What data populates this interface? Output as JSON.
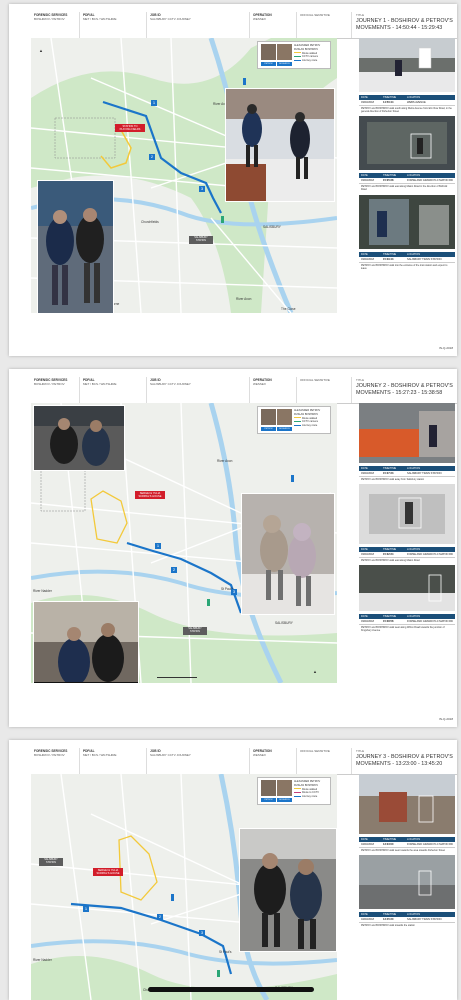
{
  "header_labels": {
    "forensic": "FORENSIC SERVICES",
    "pdf": "PDF/AL",
    "job": "JOB ID",
    "operation": "OPERATION",
    "title_label": "TITLE"
  },
  "header_values": {
    "forensic": "BOSHIROV / PETROV",
    "pdf": "MET / BCS / WILTSHIRE",
    "job": "SALISBURY CCTV JOURNEY",
    "operation": "WESSEX",
    "classification": "OFFICIAL SENSITIVE"
  },
  "pages": [
    {
      "title": "JOURNEY 1 - BOSHIROV & PETROV'S MOVEMENTS - 14:50:44 - 15:29:43",
      "map_labels": [
        "River Avon",
        "SALISBURY",
        "Churchfields",
        "River Avon",
        "The Close",
        "Bourne",
        "Wilton Road"
      ],
      "red_label": "STATION TO PLAYING FIELDS",
      "grey_label": "SALISBURY STATION",
      "nums": [
        "1",
        "2",
        "3",
        "4"
      ],
      "legend": {
        "a": "ALEXANDER PETROV",
        "b": "RUSLAN BOSHIROV",
        "c": "Route walked",
        "d": "CCTV camera",
        "e": "Journey route"
      },
      "faces": [
        "PETROV",
        "BOSHIROV"
      ],
      "table_head": [
        "DATE",
        "TIME/TIME",
        "LOCATION"
      ],
      "rows": [
        {
          "date": "03/03/2018",
          "time": "14:50:44",
          "loc": "WEBS AVENUE",
          "desc": "PETROV and BOSHIROV walk south along Webs Avenue from Elm Row Road, in the general direction of Fisherton Street"
        },
        {
          "date": "03/03/2018",
          "time": "15:05:28",
          "loc": "FORSE AND GRANDI PLC MATON RD",
          "desc": "PETROV and BOSHIROV walk east along Maton Road in the direction of Boltrold Road"
        },
        {
          "date": "03/03/2018",
          "time": "15:29:43",
          "loc": "SALISBURY TRAIN STATION",
          "desc": "PETROV and BOSHIROV walk into the entrance of the train station and expect to leave"
        }
      ],
      "footer": "IN-Q-2018"
    },
    {
      "title": "JOURNEY 2 - BOSHIROV & PETROV'S MOVEMENTS - 15:27:23 - 15:38:58",
      "map_labels": [
        "River Avon",
        "SALISBURY",
        "River Nadder",
        "St Paul's",
        "Churchfields"
      ],
      "red_label": "SERGEI & YULIA SKRIPAL'S HOUSE",
      "grey_label": "SALISBURY STATION",
      "nums": [
        "1",
        "2",
        "3",
        "4"
      ],
      "legend": {
        "a": "ALEXANDER PETROV",
        "b": "RUSLAN BOSHIROV",
        "c": "Route walked",
        "d": "CCTV camera",
        "e": "Journey route"
      },
      "faces": [
        "PETROV",
        "BOSHIROV"
      ],
      "table_head": [
        "DATE",
        "TIME/TIME",
        "LOCATION"
      ],
      "rows": [
        {
          "date": "03/03/2018",
          "time": "15:27:23",
          "loc": "SALISBURY TRAIN STATION",
          "desc": "PETROV and BOSHIROV walk away from Salisbury station"
        },
        {
          "date": "03/03/2018",
          "time": "15:32:24",
          "loc": "FORSE AND GRANDI PLC MATON RD",
          "desc": "PETROV and BOSHIROV walk east along Maton Road"
        },
        {
          "date": "03/03/2018",
          "time": "15:38:58",
          "loc": "FORSE AND GRANDI PLC MATON RD",
          "desc": "PETROV and BOSHIROV walk west along Wilton Road towards the junction of Kingsbury Avenue"
        }
      ],
      "footer": "IN-Q-2018"
    },
    {
      "title": "JOURNEY 3 - BOSHIROV & PETROV'S MOVEMENTS - 13:23:00 - 13:45:20",
      "map_labels": [
        "River Nadder",
        "St Paul's",
        "SALISBURY",
        "Churchfields"
      ],
      "red_label": "SERGEI & YULIA SKRIPAL'S HOUSE",
      "grey_label": "SALISBURY STATION",
      "nums": [
        "1",
        "2",
        "3"
      ],
      "legend": {
        "a": "ALEXANDER PETROV",
        "b": "RUSLAN BOSHIROV",
        "c": "Route walked",
        "d": "Route to CCTV",
        "e": "Journey route"
      },
      "faces": [
        "PETROV",
        "BOSHIROV"
      ],
      "table_head": [
        "DATE",
        "TIME/TIME",
        "LOCATION"
      ],
      "rows": [
        {
          "date": "04/03/2018",
          "time": "13:23:00",
          "loc": "FORSE AND GRANDI PLC MATON RD",
          "desc": "PETROV and BOSHIROV walk west towards the area towards Fisherton Street"
        },
        {
          "date": "04/03/2018",
          "time": "13:45:20",
          "loc": "SALISBURY TRAIN STATION",
          "desc": "PETROV and BOSHIROV walk towards the station"
        }
      ],
      "footer": ""
    }
  ],
  "colors": {
    "route_blue": "#1b75c9",
    "route_yellow": "#f3c93a",
    "label_red": "#d21d2a",
    "table_head": "#1b4f79"
  }
}
